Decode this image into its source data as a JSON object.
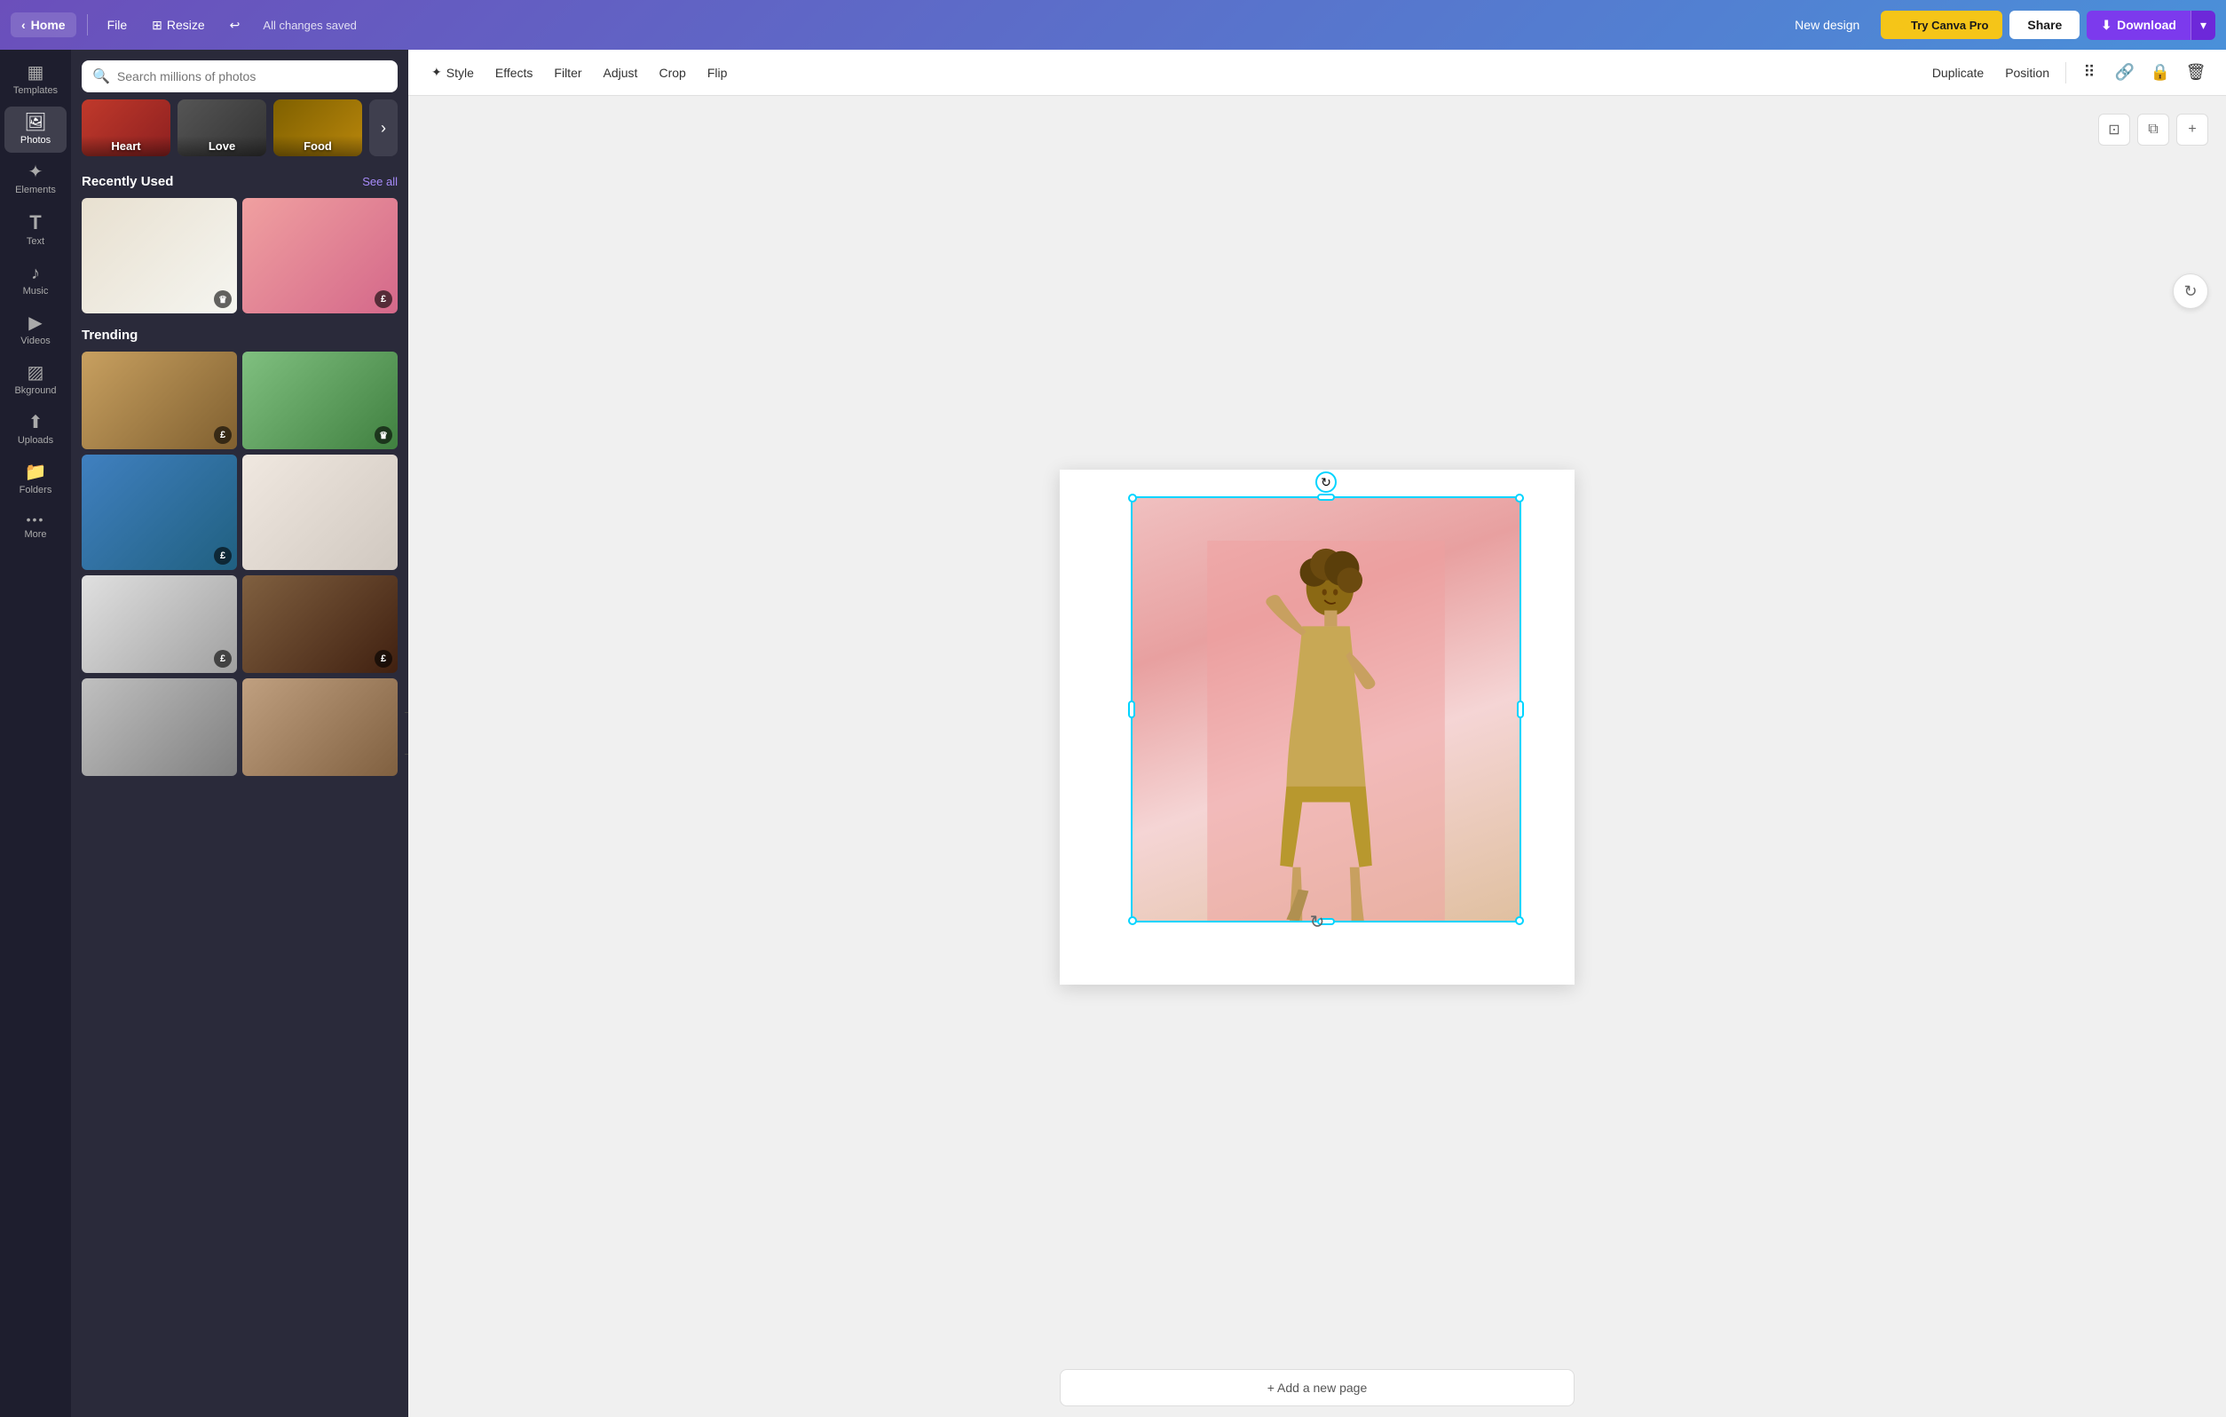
{
  "topnav": {
    "home_label": "Home",
    "file_label": "File",
    "resize_label": "Resize",
    "saved_status": "All changes saved",
    "new_design_label": "New design",
    "try_pro_label": "Try Canva Pro",
    "share_label": "Share",
    "download_label": "Download"
  },
  "sidebar": {
    "items": [
      {
        "id": "templates",
        "label": "Templates",
        "icon": "▦"
      },
      {
        "id": "photos",
        "label": "Photos",
        "icon": "🖼"
      },
      {
        "id": "elements",
        "label": "Elements",
        "icon": "✦"
      },
      {
        "id": "text",
        "label": "Text",
        "icon": "T"
      },
      {
        "id": "music",
        "label": "Music",
        "icon": "♪"
      },
      {
        "id": "videos",
        "label": "Videos",
        "icon": "▶"
      },
      {
        "id": "background",
        "label": "Bkground",
        "icon": "⬚"
      },
      {
        "id": "uploads",
        "label": "Uploads",
        "icon": "⬆"
      },
      {
        "id": "folders",
        "label": "Folders",
        "icon": "📁"
      },
      {
        "id": "more",
        "label": "More",
        "icon": "•••"
      }
    ]
  },
  "photos_panel": {
    "search_placeholder": "Search millions of photos",
    "categories": [
      {
        "label": "Heart",
        "class": "cat-heart"
      },
      {
        "label": "Love",
        "class": "cat-love"
      },
      {
        "label": "Food",
        "class": "cat-food"
      }
    ],
    "recently_used_title": "Recently Used",
    "see_all_label": "See all",
    "trending_title": "Trending",
    "photos": [
      {
        "id": "leaf",
        "class": "ph-white-leaf",
        "badge": "♛",
        "tall": true
      },
      {
        "id": "flowers",
        "class": "ph-flowers",
        "badge": "£",
        "tall": true
      },
      {
        "id": "cooking",
        "class": "ph-cooking",
        "badge": "£",
        "tall": false
      },
      {
        "id": "picnic",
        "class": "ph-picnic",
        "badge": "♛",
        "tall": false
      },
      {
        "id": "earth",
        "class": "ph-earth",
        "badge": "£",
        "tall": false
      },
      {
        "id": "woman-white",
        "class": "ph-woman-white",
        "badge": null,
        "tall": false
      },
      {
        "id": "sink",
        "class": "ph-sink",
        "badge": "£",
        "tall": false
      },
      {
        "id": "fireplace",
        "class": "ph-fireplace",
        "badge": "£",
        "tall": false
      },
      {
        "id": "grid-pattern",
        "class": "ph-grid",
        "badge": null,
        "tall": false
      },
      {
        "id": "man-apron",
        "class": "ph-man-apron",
        "badge": null,
        "tall": false
      }
    ]
  },
  "toolbar": {
    "style_label": "Style",
    "effects_label": "Effects",
    "filter_label": "Filter",
    "adjust_label": "Adjust",
    "crop_label": "Crop",
    "flip_label": "Flip",
    "duplicate_label": "Duplicate",
    "position_label": "Position"
  },
  "canvas": {
    "add_page_label": "+ Add a new page"
  }
}
